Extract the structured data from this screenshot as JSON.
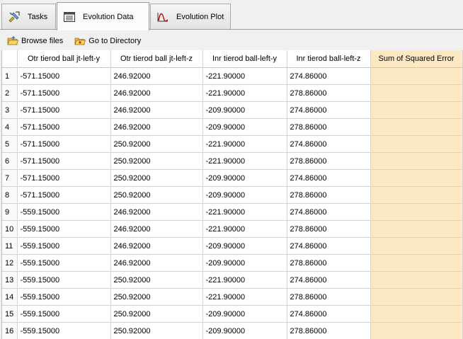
{
  "tabs": [
    {
      "label": "Tasks",
      "icon": "tasks-icon",
      "active": false
    },
    {
      "label": "Evolution Data",
      "icon": "table-icon",
      "active": true
    },
    {
      "label": "Evolution Plot",
      "icon": "plot-icon",
      "active": false
    }
  ],
  "toolbar": {
    "browse_label": "Browse files",
    "goto_label": "Go to Directory"
  },
  "table": {
    "columns": [
      "",
      "Otr tierod ball jt-left-y",
      "Otr tierod ball jt-left-z",
      "Inr tierod ball-left-y",
      "Inr tierod ball-left-z",
      "Sum of Squared Error"
    ],
    "rows": [
      [
        "1",
        "-571.15000",
        "246.92000",
        "-221.90000",
        "274.86000",
        ""
      ],
      [
        "2",
        "-571.15000",
        "246.92000",
        "-221.90000",
        "278.86000",
        ""
      ],
      [
        "3",
        "-571.15000",
        "246.92000",
        "-209.90000",
        "274.86000",
        ""
      ],
      [
        "4",
        "-571.15000",
        "246.92000",
        "-209.90000",
        "278.86000",
        ""
      ],
      [
        "5",
        "-571.15000",
        "250.92000",
        "-221.90000",
        "274.86000",
        ""
      ],
      [
        "6",
        "-571.15000",
        "250.92000",
        "-221.90000",
        "278.86000",
        ""
      ],
      [
        "7",
        "-571.15000",
        "250.92000",
        "-209.90000",
        "274.86000",
        ""
      ],
      [
        "8",
        "-571.15000",
        "250.92000",
        "-209.90000",
        "278.86000",
        ""
      ],
      [
        "9",
        "-559.15000",
        "246.92000",
        "-221.90000",
        "274.86000",
        ""
      ],
      [
        "10",
        "-559.15000",
        "246.92000",
        "-221.90000",
        "278.86000",
        ""
      ],
      [
        "11",
        "-559.15000",
        "246.92000",
        "-209.90000",
        "274.86000",
        ""
      ],
      [
        "12",
        "-559.15000",
        "246.92000",
        "-209.90000",
        "278.86000",
        ""
      ],
      [
        "13",
        "-559.15000",
        "250.92000",
        "-221.90000",
        "274.86000",
        ""
      ],
      [
        "14",
        "-559.15000",
        "250.92000",
        "-221.90000",
        "278.86000",
        ""
      ],
      [
        "15",
        "-559.15000",
        "250.92000",
        "-209.90000",
        "274.86000",
        ""
      ],
      [
        "16",
        "-559.15000",
        "250.92000",
        "-209.90000",
        "278.86000",
        ""
      ]
    ]
  },
  "colors": {
    "sse_highlight": "#fde8c4",
    "plot_icon": "#c00000"
  }
}
